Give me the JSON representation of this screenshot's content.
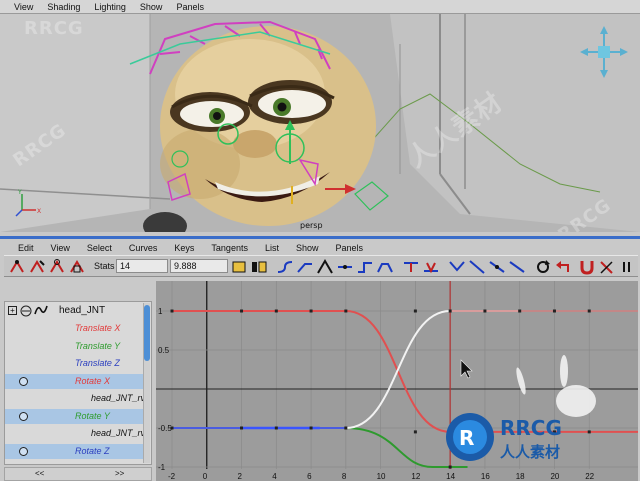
{
  "viewport": {
    "menu": [
      "View",
      "Shading",
      "Lighting",
      "Show",
      "Panels"
    ],
    "label_persp": "persp"
  },
  "graph_editor": {
    "menu": [
      "Edit",
      "View",
      "Select",
      "Curves",
      "Keys",
      "Tangents",
      "List",
      "Show",
      "Panels"
    ],
    "stats_label": "Stats",
    "stats_value_1": "14",
    "stats_value_2": "9.888",
    "outliner": {
      "object": "head_JNT",
      "rows": [
        {
          "label": "Translate X",
          "color": "#e23b3b",
          "selected": false
        },
        {
          "label": "Translate Y",
          "color": "#2f9c2f",
          "selected": false
        },
        {
          "label": "Translate Z",
          "color": "#2b3fbf",
          "selected": false
        },
        {
          "label": "Rotate X",
          "color": "#e23b3b",
          "selected": true
        },
        {
          "label": "head_JNT_rv",
          "color": "#111111",
          "selected": false
        },
        {
          "label": "Rotate Y",
          "color": "#2f9c2f",
          "selected": true
        },
        {
          "label": "head_JNT_rv",
          "color": "#111111",
          "selected": false
        },
        {
          "label": "Rotate Z",
          "color": "#2b3fbf",
          "selected": true
        }
      ]
    },
    "x_ticks": [
      "-2",
      "0",
      "2",
      "4",
      "6",
      "8",
      "10",
      "12",
      "14",
      "16",
      "18",
      "20",
      "22"
    ],
    "y_ticks": [
      "1",
      "0.5",
      "-0.5",
      "-1"
    ]
  },
  "watermark": {
    "brand": "RRCG",
    "chinese": "人人素材"
  },
  "colors": {
    "accent": "#3a6dc9",
    "curve_red": "#e05050",
    "curve_green": "#2e9a2e",
    "curve_blue": "#4a5ce0",
    "curve_white": "#f2f2f2",
    "current_time": "#b03030"
  }
}
